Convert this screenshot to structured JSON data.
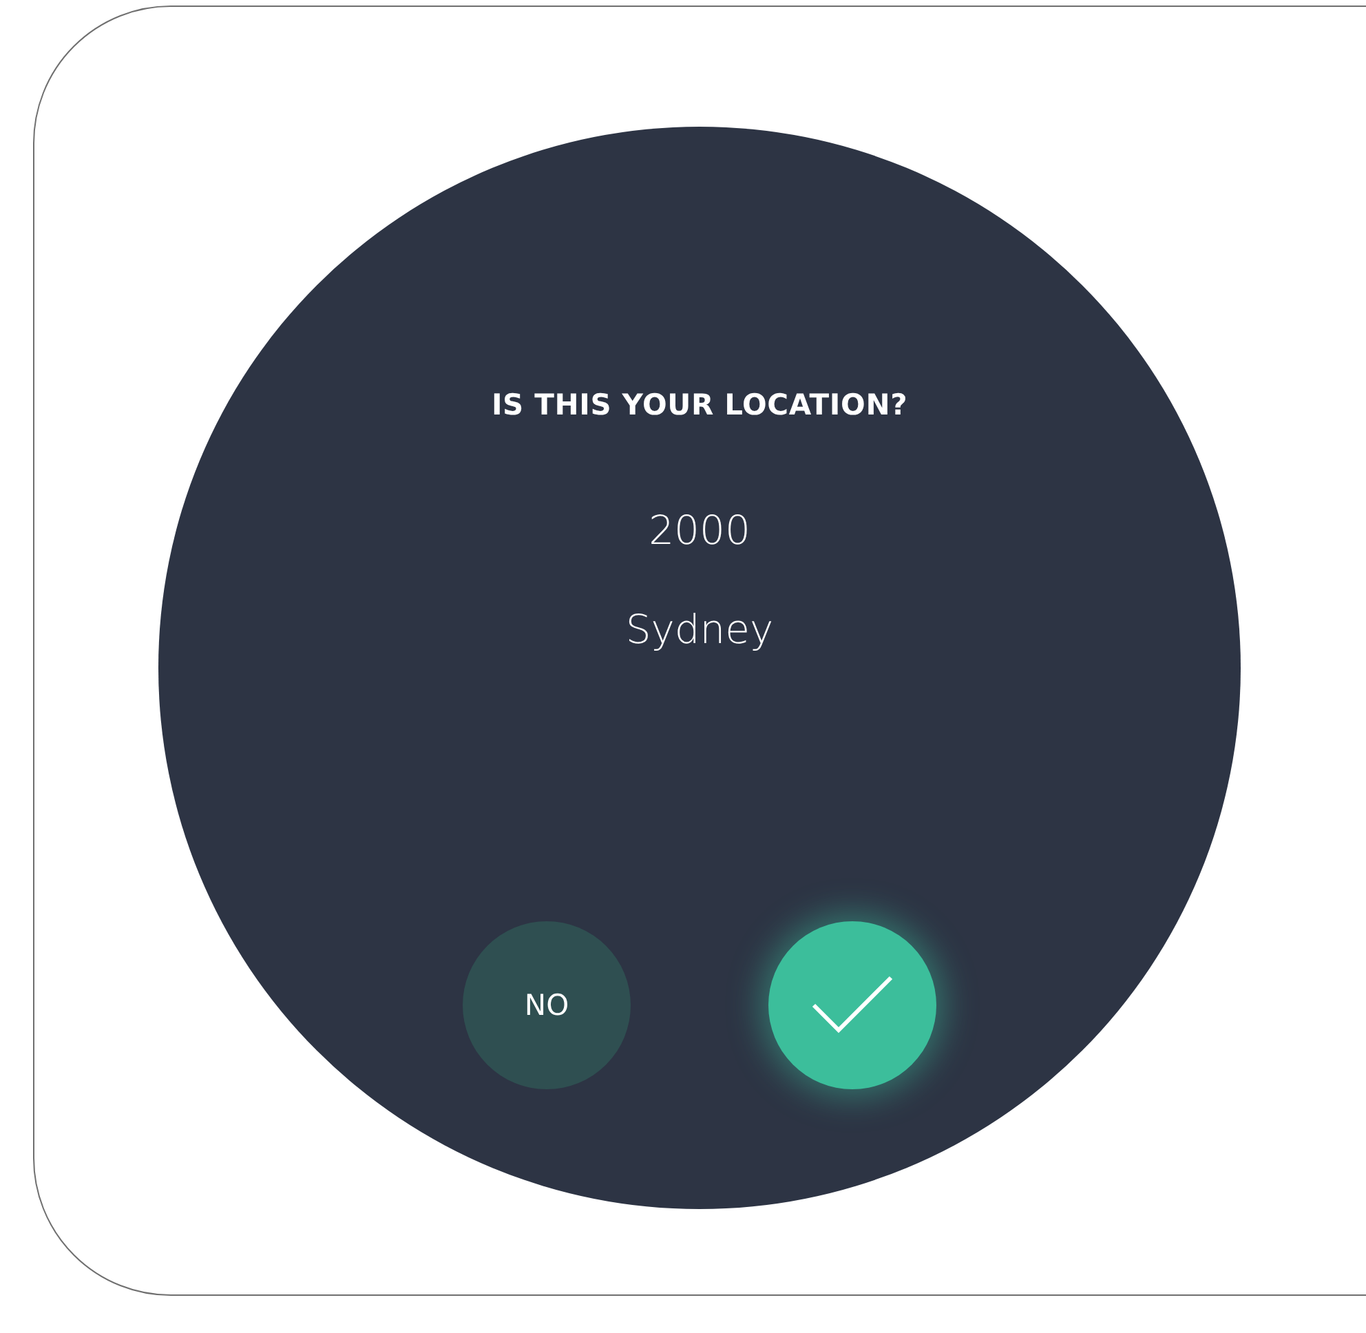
{
  "prompt": {
    "title": "IS THIS YOUR LOCATION?",
    "postcode": "2000",
    "city": "Sydney"
  },
  "buttons": [
    {
      "kind": "text",
      "label": "NO"
    },
    {
      "kind": "confirm"
    }
  ]
}
